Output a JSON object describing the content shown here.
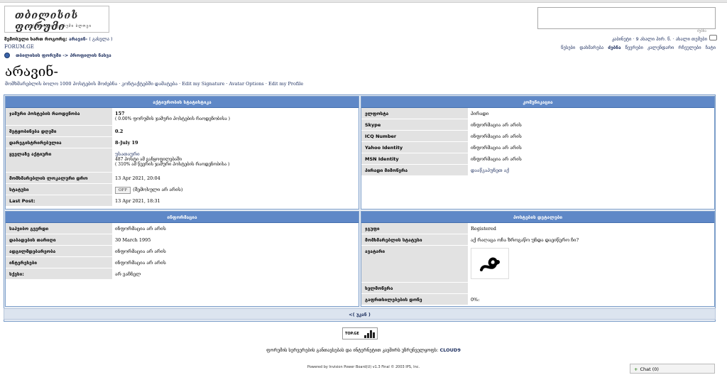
{
  "header": {
    "logo_title": "თბილისის ფორუმი",
    "logo_subtitle": "ქართული ფორუმი ბლოგი",
    "search_caption": "ძებნა",
    "welcome_prefix": "შემოსული ხართ როგორც:",
    "welcome_user": "არავინ-",
    "logout_label": "( გასვლა )",
    "site_name": "FORUM.GE",
    "userbar_text": "კაბინეტი · 9 ახალი პირ. წ. · ახალი თემები",
    "nav_items": [
      "წესები",
      "დახმარება",
      "ძებნა",
      "წევრები",
      "კალენდარი",
      "რჩეულები",
      "ჩატი"
    ]
  },
  "breadcrumb": {
    "forum": "თბილისის ფორუმი",
    "separator": "->",
    "page": "პროფილის ნახვა"
  },
  "profile": {
    "name": "არავინ-",
    "links": "მომხმარებლის ბოლო 1000 პოსტების მოძებნა · კონტაქტებში დამატება · Edit my Signature · Avatar Options · Edit my Profile"
  },
  "activity": {
    "title": "აქტიურობის სტატისტიკა",
    "rows": [
      {
        "label": "ჯამური პოსტების რაოდენობა",
        "value": "157",
        "sub": "( 0.00% ფორუმის ჯამური პოსტების რაოდენობისა )"
      },
      {
        "label": "შეტყობინება დღეში",
        "value": "0.2"
      },
      {
        "label": "დარეგისტრირებულია",
        "value": "8-July 19"
      },
      {
        "label": "ყველაზე აქტიური",
        "value": "უსათაური",
        "sub1": "487 პოსტი ამ განყოფილებაში",
        "sub2": "( 310% ამ წევრის ჯამური პოსტების რაოდენობისა )"
      },
      {
        "label": "მომხმარებლის ლოკალური დრო",
        "value": "13 Apr 2021, 20:04"
      },
      {
        "label": "სტატუსი",
        "badge": "OFF",
        "value": "(შემოსული არ არის)"
      },
      {
        "label": "Last Post:",
        "value": "13 Apr 2021, 18:31"
      }
    ]
  },
  "communication": {
    "title": "კომუნიკაცია",
    "rows": [
      {
        "label": "ელფოსტა",
        "value": "პირადი"
      },
      {
        "label": "Skype",
        "value": "ინფორმაცია არ არის"
      },
      {
        "label": "ICQ Number",
        "value": "ინფორმაცია არ არის"
      },
      {
        "label": "Yahoo Identity",
        "value": "ინფორმაცია არ არის"
      },
      {
        "label": "MSN Identity",
        "value": "ინფორმაცია არ არის"
      },
      {
        "label": "პირადი მიმოწერა",
        "value": "დააწკაპუნეთ აქ"
      }
    ]
  },
  "information": {
    "title": "ინფორმაცია",
    "rows": [
      {
        "label": "საჰვიბო გვერდი",
        "value": "ინფორმაცია არ არის"
      },
      {
        "label": "დაბადების თარიღი",
        "value": "30 March 1995"
      },
      {
        "label": "ადგილმდებარეობა",
        "value": "ინფორმაცია არ არის"
      },
      {
        "label": "ინტერესები",
        "value": "ინფორმაცია არ არის"
      },
      {
        "label": "სქესი:",
        "value": "არ ვაჩნელ"
      }
    ]
  },
  "post_details": {
    "title": "პოსტების დეტალები",
    "rows": [
      {
        "label": "ჯგუფი",
        "value": "Registered"
      },
      {
        "label": "მომხმარებლის სტატუსი",
        "value": "აქ რაღაცა ოჩა ზროგაწო უნდა დაეიწერო ჩი?"
      },
      {
        "label": "ავატარი",
        "value": ""
      },
      {
        "label": "ხელმოწერა",
        "value": ""
      },
      {
        "label": "გაფრთხილებების დონე",
        "value": "0%:"
      }
    ]
  },
  "back_link": "<( უკან )",
  "topge_label": "TOP.GE",
  "footer": {
    "hosting_text": "ფორუმის სერვერების განთავსებას და ინტერნეტით კავშირს უზრუნველყოფს:",
    "hosting_name": "CLOUD9",
    "powered": "Powered by Invision Power Board(U) v1.3 Final © 2003  IPS, Inc."
  },
  "chat": {
    "label": "Chat (0)"
  }
}
